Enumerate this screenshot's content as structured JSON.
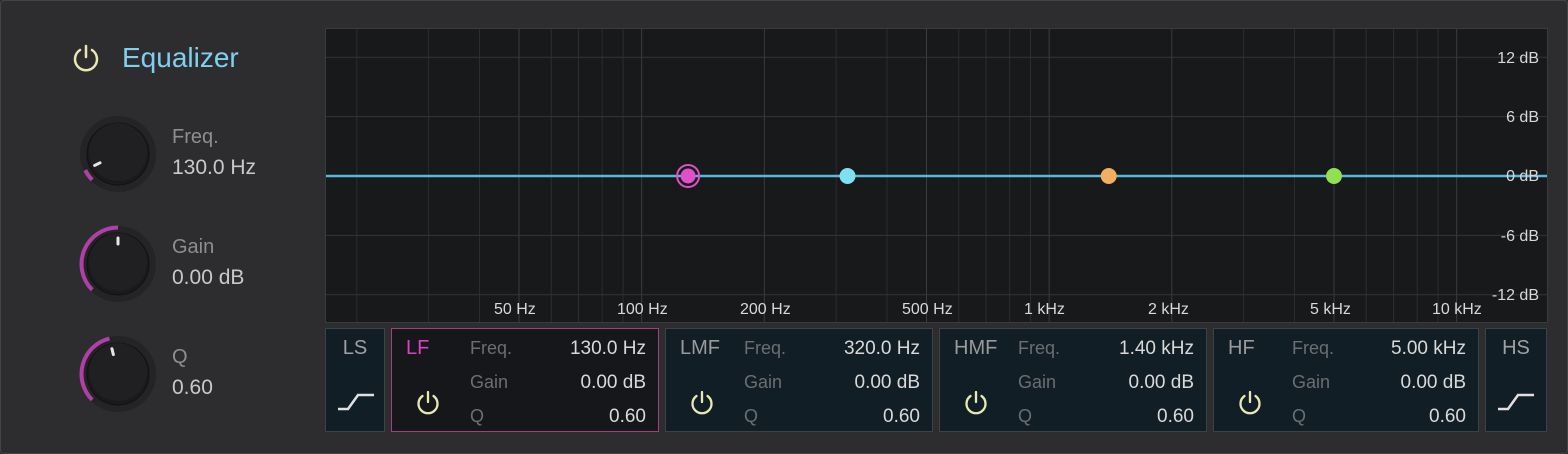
{
  "plugin": {
    "title": "Equalizer"
  },
  "knobs": [
    {
      "label": "Freq.",
      "value": "130.0 Hz",
      "level": 0.07
    },
    {
      "label": "Gain",
      "value": "0.00 dB",
      "level": 0.5
    },
    {
      "label": "Q",
      "value": "0.60",
      "level": 0.45
    }
  ],
  "graph": {
    "freq_labels": [
      "50 Hz",
      "100 Hz",
      "200 Hz",
      "500 Hz",
      "1 kHz",
      "2 kHz",
      "5 kHz",
      "10 kHz"
    ],
    "db_labels": [
      "12 dB",
      "6 dB",
      "0 dB",
      "-6 dB",
      "-12 dB"
    ],
    "curve_color": "#5ab8dc",
    "nodes": [
      {
        "band": "LF",
        "freq_hz": 130,
        "gain_db": 0,
        "color": "#e050c8",
        "selected": true
      },
      {
        "band": "LMF",
        "freq_hz": 320,
        "gain_db": 0,
        "color": "#7fe0f0",
        "selected": false
      },
      {
        "band": "HMF",
        "freq_hz": 1400,
        "gain_db": 0,
        "color": "#f0b060",
        "selected": false
      },
      {
        "band": "HF",
        "freq_hz": 5000,
        "gain_db": 0,
        "color": "#90e050",
        "selected": false
      }
    ]
  },
  "bands": {
    "ls": {
      "name": "LS"
    },
    "hs": {
      "name": "HS"
    },
    "lf": {
      "name": "LF",
      "name_color": "#e040c0",
      "freq_label": "Freq.",
      "freq": "130.0 Hz",
      "gain_label": "Gain",
      "gain": "0.00 dB",
      "q_label": "Q",
      "q": "0.60"
    },
    "lmf": {
      "name": "LMF",
      "freq_label": "Freq.",
      "freq": "320.0 Hz",
      "gain_label": "Gain",
      "gain": "0.00 dB",
      "q_label": "Q",
      "q": "0.60"
    },
    "hmf": {
      "name": "HMF",
      "freq_label": "Freq.",
      "freq": "1.40 kHz",
      "gain_label": "Gain",
      "gain": "0.00 dB",
      "q_label": "Q",
      "q": "0.60"
    },
    "hf": {
      "name": "HF",
      "freq_label": "Freq.",
      "freq": "5.00 kHz",
      "gain_label": "Gain",
      "gain": "0.00 dB",
      "q_label": "Q",
      "q": "0.60"
    }
  },
  "colors": {
    "accent": "#7fd0f0",
    "power_on": "#e8e8b0",
    "knob_arc": "#b040a8"
  }
}
